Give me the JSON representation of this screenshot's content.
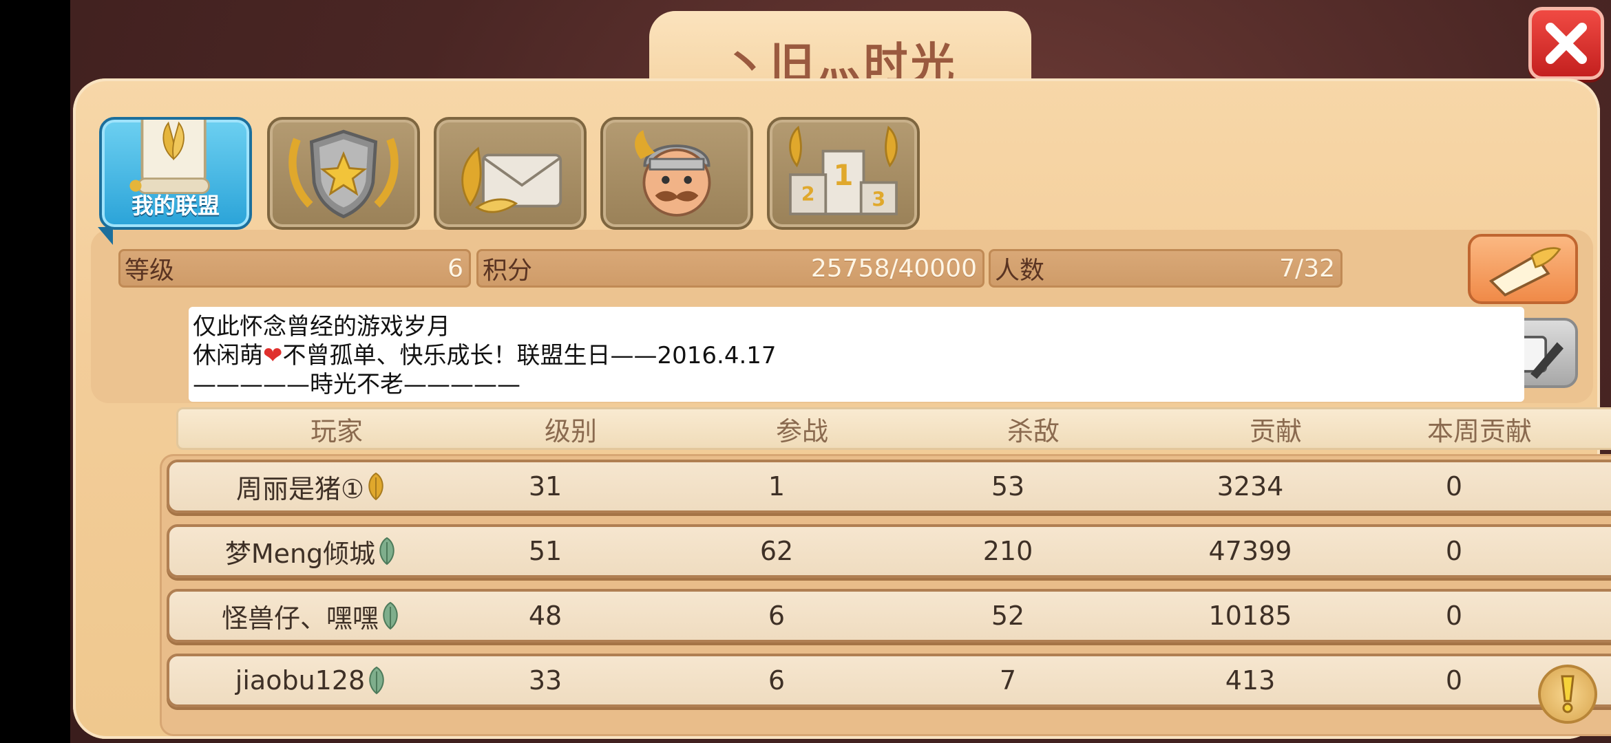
{
  "window": {
    "title": "丶旧灬时光"
  },
  "tabs": [
    {
      "label": "我的联盟",
      "icon": "scroll-laurel-icon",
      "active": true
    },
    {
      "label": "",
      "icon": "shield-star-icon",
      "active": false
    },
    {
      "label": "",
      "icon": "laurel-mail-icon",
      "active": false
    },
    {
      "label": "",
      "icon": "viking-face-icon",
      "active": false
    },
    {
      "label": "",
      "icon": "podium-icon",
      "active": false
    }
  ],
  "stats": {
    "level_label": "等级",
    "level_value": "6",
    "points_label": "积分",
    "points_value": "25758/40000",
    "members_label": "人数",
    "members_value": "7/32"
  },
  "notice": {
    "line1": "仅此怀念曾经的游戏岁月",
    "line2a": "休闲萌",
    "line2_heart": "❤",
    "line2b": "不曾孤单、快乐成长！联盟生日——2016.4.17",
    "line3": "—————時光不老—————"
  },
  "table": {
    "headers": [
      "玩家",
      "级别",
      "参战",
      "杀敌",
      "贡献",
      "本周贡献"
    ],
    "rows": [
      {
        "player": "周丽是猪①",
        "level": "31",
        "battles": "1",
        "kills": "53",
        "contribution": "3234",
        "weekly": "0",
        "leaf": "gold"
      },
      {
        "player": "梦Meng倾城",
        "level": "51",
        "battles": "62",
        "kills": "210",
        "contribution": "47399",
        "weekly": "0",
        "leaf": "green"
      },
      {
        "player": "怪兽仔、嘿嘿",
        "level": "48",
        "battles": "6",
        "kills": "52",
        "contribution": "10185",
        "weekly": "0",
        "leaf": "green"
      },
      {
        "player": "jiaobu128",
        "level": "33",
        "battles": "6",
        "kills": "7",
        "contribution": "413",
        "weekly": "0",
        "leaf": "green"
      }
    ]
  },
  "colors": {
    "accent_blue": "#2aa3d8",
    "close_red": "#e03a35",
    "gold_leaf": "#e0a82c",
    "green_leaf": "#7fae8c"
  }
}
